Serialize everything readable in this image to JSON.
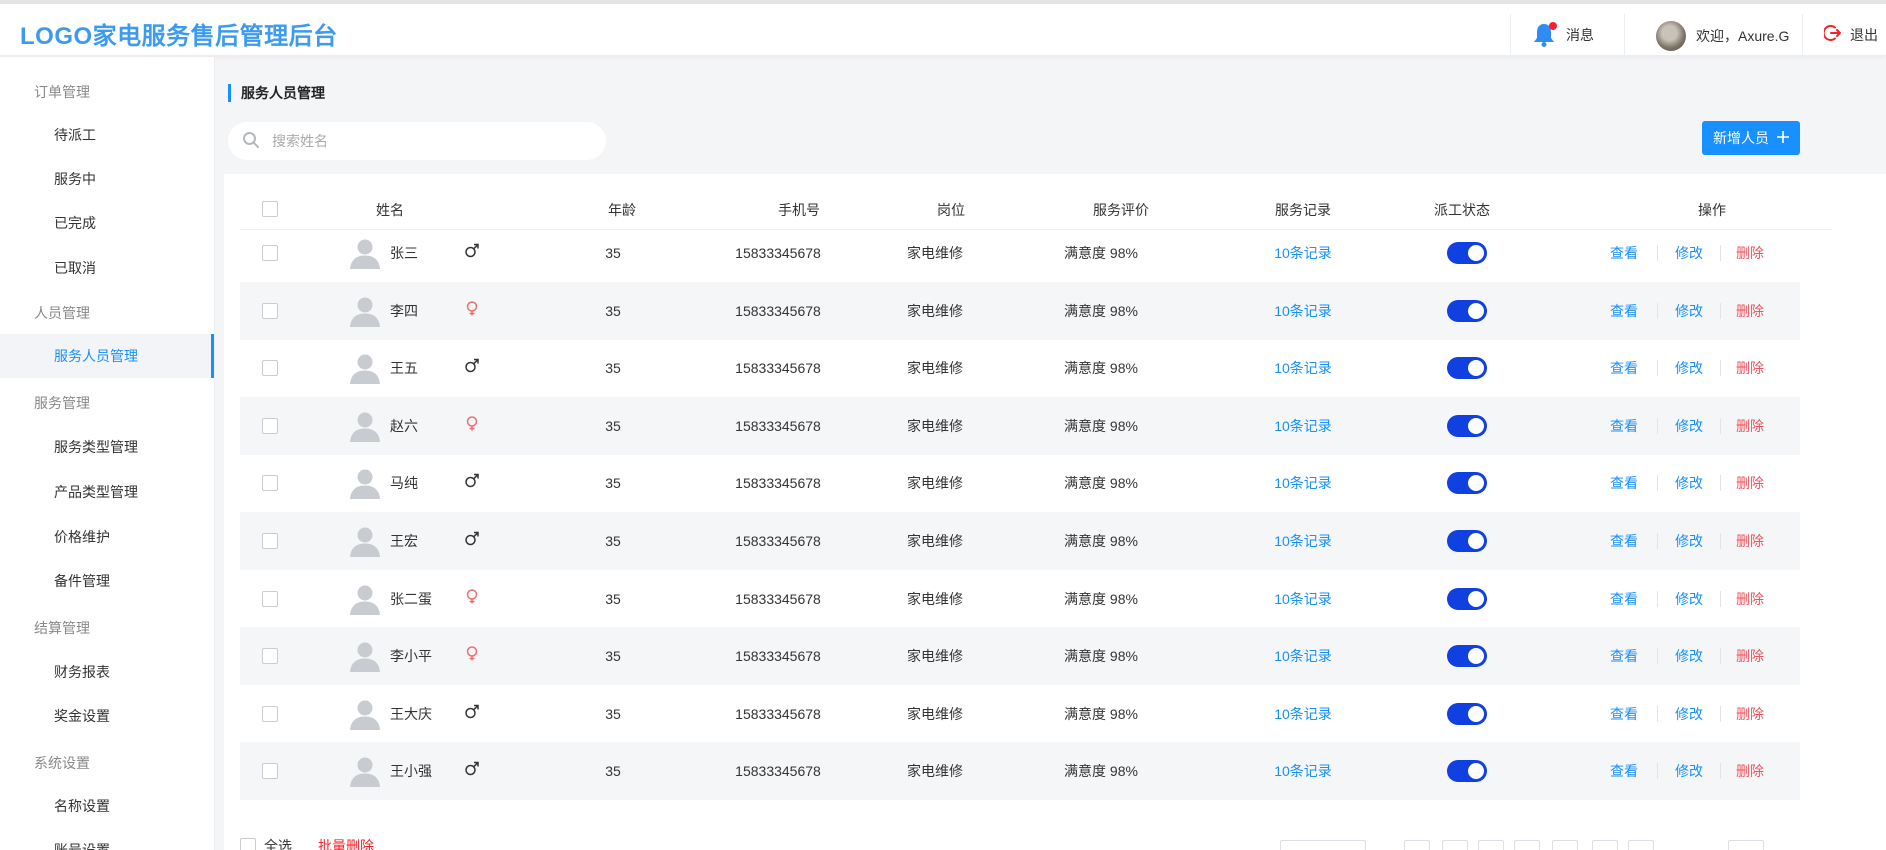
{
  "header": {
    "logo": "LOGO家电服务售后管理后台",
    "messages_label": "消息",
    "welcome": "欢迎，Axure.G",
    "logout": "退出"
  },
  "sidebar": {
    "groups": [
      {
        "title": "订单管理",
        "items": [
          "待派工",
          "服务中",
          "已完成",
          "已取消"
        ]
      },
      {
        "title": "人员管理",
        "items": [
          "服务人员管理"
        ]
      },
      {
        "title": "服务管理",
        "items": [
          "服务类型管理",
          "产品类型管理",
          "价格维护",
          "备件管理"
        ]
      },
      {
        "title": "结算管理",
        "items": [
          "财务报表",
          "奖金设置"
        ]
      },
      {
        "title": "系统设置",
        "items": [
          "名称设置",
          "账号设置"
        ]
      }
    ],
    "active_item": "服务人员管理"
  },
  "main": {
    "title": "服务人员管理",
    "search_placeholder": "搜索姓名",
    "add_button": "新增人员",
    "columns": [
      "姓名",
      "年龄",
      "手机号",
      "岗位",
      "服务评价",
      "服务记录",
      "派工状态",
      "操作"
    ],
    "actions": {
      "view": "查看",
      "edit": "修改",
      "delete": "删除"
    },
    "rows": [
      {
        "name": "张三",
        "gender": "male",
        "age": "35",
        "phone": "15833345678",
        "post": "家电维修",
        "rating": "满意度 98%",
        "records": "10条记录",
        "dispatch_on": true
      },
      {
        "name": "李四",
        "gender": "female",
        "age": "35",
        "phone": "15833345678",
        "post": "家电维修",
        "rating": "满意度 98%",
        "records": "10条记录",
        "dispatch_on": true
      },
      {
        "name": "王五",
        "gender": "male",
        "age": "35",
        "phone": "15833345678",
        "post": "家电维修",
        "rating": "满意度 98%",
        "records": "10条记录",
        "dispatch_on": true
      },
      {
        "name": "赵六",
        "gender": "female",
        "age": "35",
        "phone": "15833345678",
        "post": "家电维修",
        "rating": "满意度 98%",
        "records": "10条记录",
        "dispatch_on": true
      },
      {
        "name": "马纯",
        "gender": "male",
        "age": "35",
        "phone": "15833345678",
        "post": "家电维修",
        "rating": "满意度 98%",
        "records": "10条记录",
        "dispatch_on": true
      },
      {
        "name": "王宏",
        "gender": "male",
        "age": "35",
        "phone": "15833345678",
        "post": "家电维修",
        "rating": "满意度 98%",
        "records": "10条记录",
        "dispatch_on": true
      },
      {
        "name": "张二蛋",
        "gender": "female",
        "age": "35",
        "phone": "15833345678",
        "post": "家电维修",
        "rating": "满意度 98%",
        "records": "10条记录",
        "dispatch_on": true
      },
      {
        "name": "李小平",
        "gender": "female",
        "age": "35",
        "phone": "15833345678",
        "post": "家电维修",
        "rating": "满意度 98%",
        "records": "10条记录",
        "dispatch_on": true
      },
      {
        "name": "王大庆",
        "gender": "male",
        "age": "35",
        "phone": "15833345678",
        "post": "家电维修",
        "rating": "满意度 98%",
        "records": "10条记录",
        "dispatch_on": true
      },
      {
        "name": "王小强",
        "gender": "male",
        "age": "35",
        "phone": "15833345678",
        "post": "家电维修",
        "rating": "满意度 98%",
        "records": "10条记录",
        "dispatch_on": true
      }
    ],
    "footer": {
      "select_all": "全选",
      "batch_delete": "批量删除"
    }
  },
  "colors": {
    "accent": "#1890ff",
    "logo": "#3c9af0",
    "toggle": "#1040e0",
    "danger": "#f5525c",
    "female": "#ef6f6f"
  },
  "icons": {
    "bell": "bell-icon",
    "logout": "logout-icon",
    "search": "search-icon",
    "add": "plus-icon",
    "person": "user-avatar-icon",
    "male": "male-symbol-icon",
    "female": "female-symbol-icon"
  }
}
